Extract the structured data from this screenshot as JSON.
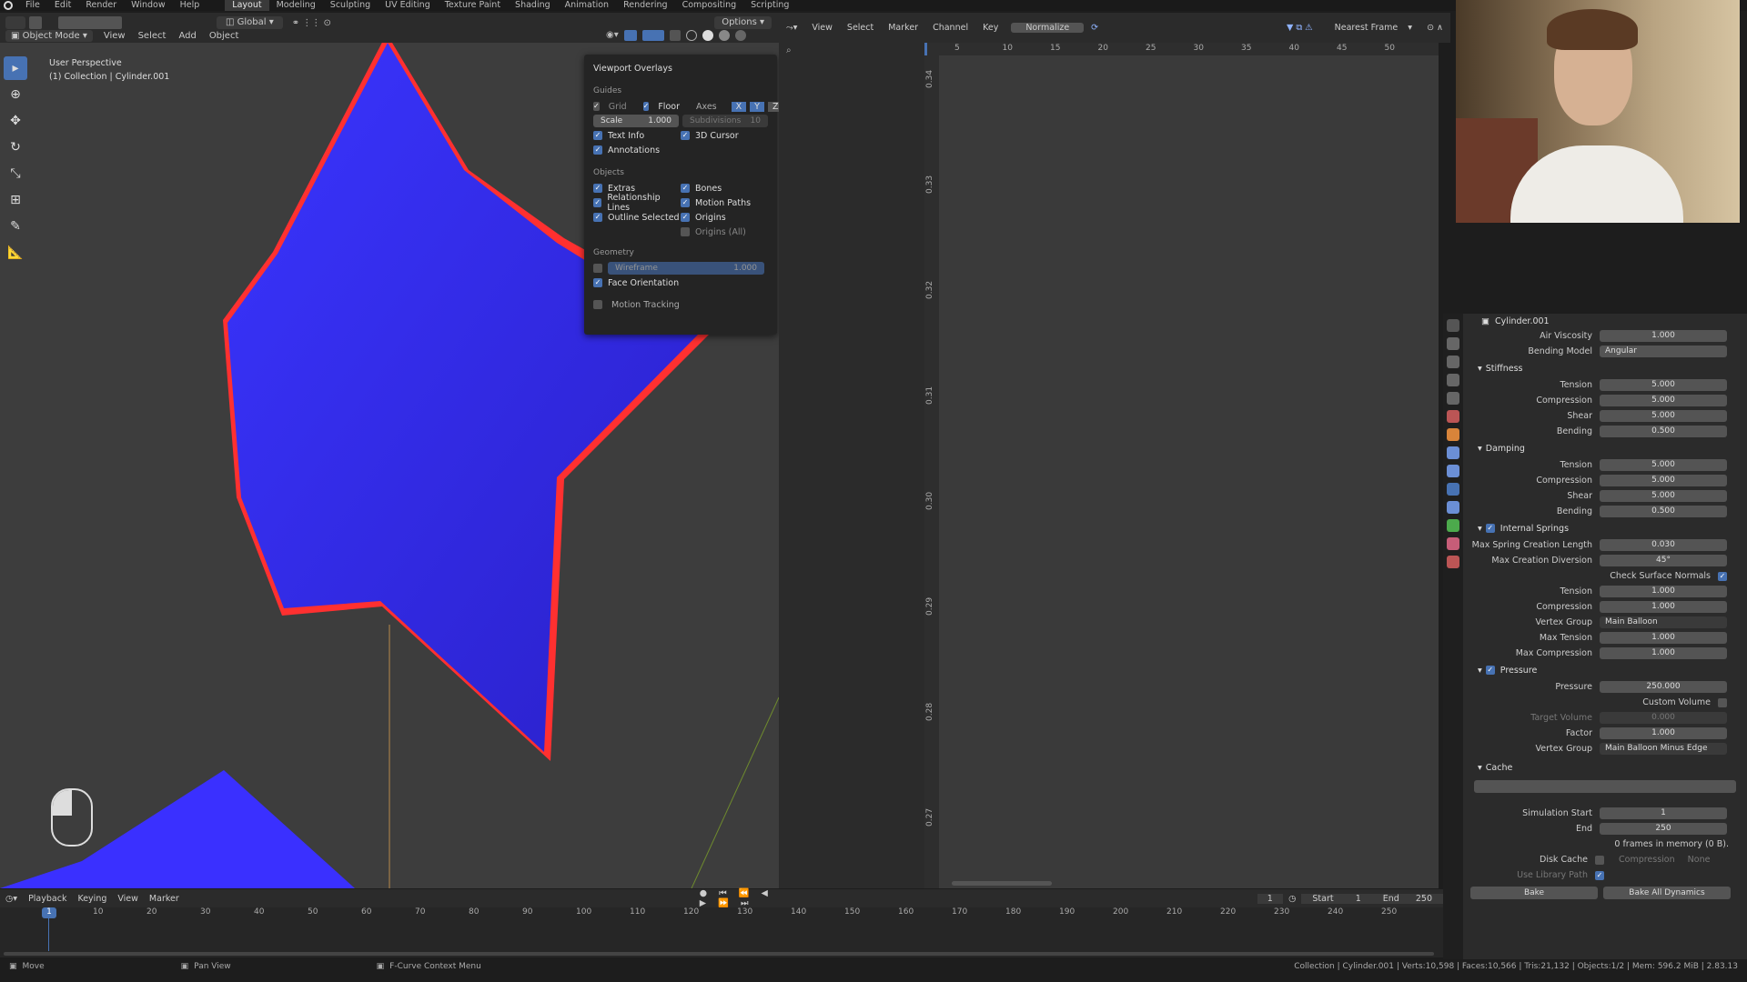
{
  "topbar": {
    "menus": [
      "File",
      "Edit",
      "Render",
      "Window",
      "Help"
    ],
    "workspaces": [
      "Layout",
      "Modeling",
      "Sculpting",
      "UV Editing",
      "Texture Paint",
      "Shading",
      "Animation",
      "Rendering",
      "Compositing",
      "Scripting"
    ],
    "active_workspace": "Layout"
  },
  "viewport": {
    "mode": "Object Mode",
    "menus": [
      "View",
      "Select",
      "Add",
      "Object"
    ],
    "transform": "Global",
    "options": "Options",
    "info_line1": "User Perspective",
    "info_line2": "(1) Collection | Cylinder.001"
  },
  "overlays": {
    "title": "Viewport Overlays",
    "guides": "Guides",
    "grid": "Grid",
    "floor": "Floor",
    "axes": "Axes",
    "axis_x": "X",
    "axis_y": "Y",
    "axis_z": "Z",
    "scale_label": "Scale",
    "scale_value": "1.000",
    "subdiv_label": "Subdivisions",
    "subdiv_value": "10",
    "text_info": "Text Info",
    "cursor_3d": "3D Cursor",
    "annotations": "Annotations",
    "objects": "Objects",
    "extras": "Extras",
    "bones": "Bones",
    "relationship_lines": "Relationship Lines",
    "motion_paths": "Motion Paths",
    "outline_selected": "Outline Selected",
    "origins": "Origins",
    "origins_all": "Origins (All)",
    "geometry": "Geometry",
    "wireframe": "Wireframe",
    "wireframe_value": "1.000",
    "face_orientation": "Face Orientation",
    "motion_tracking": "Motion Tracking"
  },
  "graph": {
    "menus": [
      "View",
      "Select",
      "Marker",
      "Channel",
      "Key"
    ],
    "normalize": "Normalize",
    "snap": "Nearest Frame",
    "x_ticks": [
      "5",
      "10",
      "15",
      "20",
      "25",
      "30",
      "35",
      "40",
      "45",
      "50"
    ],
    "y_ticks": [
      "0.34",
      "0.33",
      "0.32",
      "0.31",
      "0.30",
      "0.29",
      "0.28",
      "0.27"
    ]
  },
  "props": {
    "object_name": "Cylinder.001",
    "air_viscosity_label": "Air Viscosity",
    "air_viscosity": "1.000",
    "bending_model_label": "Bending Model",
    "bending_model": "Angular",
    "stiffness": "Stiffness",
    "s_tension": "5.000",
    "s_compression": "5.000",
    "s_shear": "5.000",
    "s_bending": "0.500",
    "damping": "Damping",
    "d_tension": "5.000",
    "d_compression": "5.000",
    "d_shear": "5.000",
    "d_bending": "0.500",
    "tension_label": "Tension",
    "compression_label": "Compression",
    "shear_label": "Shear",
    "bending_label": "Bending",
    "internal_springs": "Internal Springs",
    "max_spring_label": "Max Spring Creation Length",
    "max_spring": "0.030",
    "max_diversion_label": "Max Creation Diversion",
    "max_diversion": "45°",
    "check_normals": "Check Surface Normals",
    "i_tension": "1.000",
    "i_compression": "1.000",
    "vertex_group_label": "Vertex Group",
    "vertex_group_1": "Main Balloon",
    "max_tension_label": "Max Tension",
    "max_tension": "1.000",
    "max_compression_label": "Max Compression",
    "max_compression": "1.000",
    "pressure_section": "Pressure",
    "pressure_label": "Pressure",
    "pressure": "250.000",
    "custom_volume": "Custom Volume",
    "target_volume_label": "Target Volume",
    "target_volume": "0.000",
    "factor_label": "Factor",
    "factor": "1.000",
    "vertex_group_2": "Main Balloon Minus Edge",
    "cache": "Cache",
    "sim_start_label": "Simulation Start",
    "sim_start": "1",
    "end_label": "End",
    "end": "250",
    "frames_mem": "0 frames in memory (0 B).",
    "disk_cache": "Disk Cache",
    "compression_cache_label": "Compression",
    "compression_cache": "None",
    "use_library_path": "Use Library Path",
    "bake": "Bake",
    "bake_all": "Bake All Dynamics"
  },
  "timeline": {
    "menus": [
      "Playback",
      "Keying",
      "View",
      "Marker"
    ],
    "current_frame": "1",
    "start_label": "Start",
    "start": "1",
    "end_label": "End",
    "end": "250",
    "ticks": [
      "1",
      "10",
      "20",
      "30",
      "40",
      "50",
      "60",
      "70",
      "80",
      "90",
      "100",
      "110",
      "120",
      "130",
      "140",
      "150",
      "160",
      "170",
      "180",
      "190",
      "200",
      "210",
      "220",
      "230",
      "240",
      "250"
    ]
  },
  "status": {
    "move": "Move",
    "pan": "Pan View",
    "context": "F-Curve Context Menu",
    "stats": "Collection | Cylinder.001 | Verts:10,598 | Faces:10,566 | Tris:21,132 | Objects:1/2 | Mem: 596.2 MiB | 2.83.13"
  }
}
